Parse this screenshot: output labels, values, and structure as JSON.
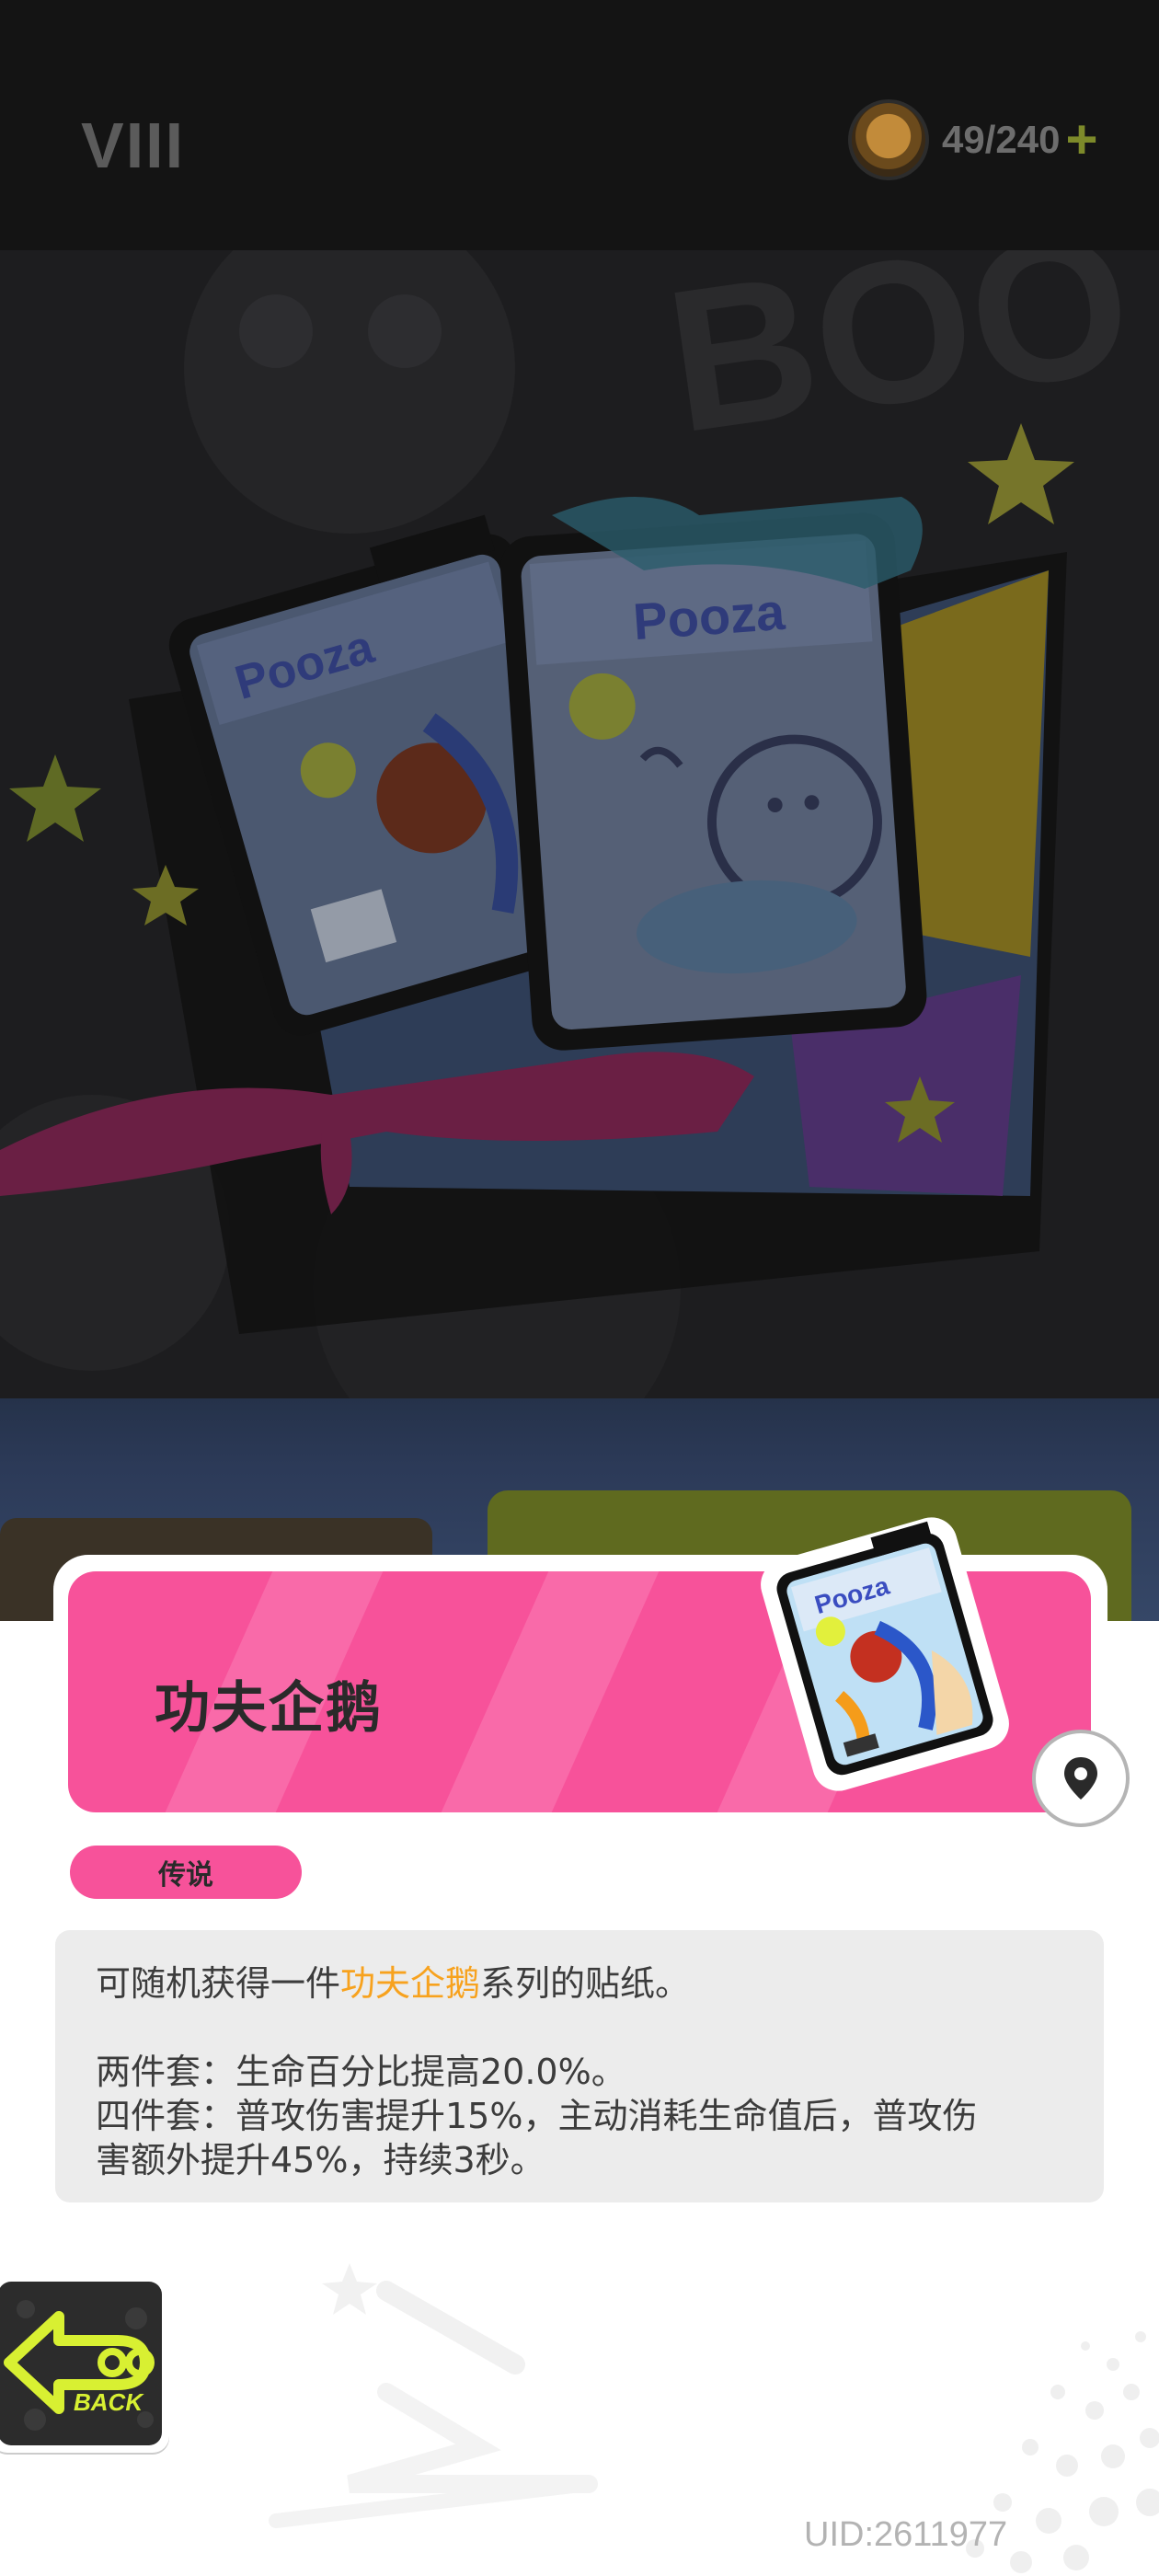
{
  "header": {
    "chapter": "VIII",
    "currency": {
      "icon": "coin-icon",
      "value": "49/240",
      "add_icon": "plus-icon"
    }
  },
  "item": {
    "name": "功夫企鹅",
    "rarity": "传说",
    "icon": "sticker-pack-icon"
  },
  "description": {
    "line1": {
      "before": "可随机获得一件",
      "highlight": "功夫企鹅",
      "after": "系列的贴纸。"
    },
    "set2": "两件套：生命百分比提高20.0%。",
    "set4_line1": "四件套：普攻伤害提升15%，主动消耗生命值后，普攻伤",
    "set4_line2": "害额外提升45%，持续3秒。"
  },
  "footer": {
    "back_label": "BACK",
    "uid": "UID:2611977"
  },
  "colors": {
    "accent_pink": "#f7529a",
    "highlight_orange": "#f7a21e",
    "back_yellow": "#d8f032"
  }
}
